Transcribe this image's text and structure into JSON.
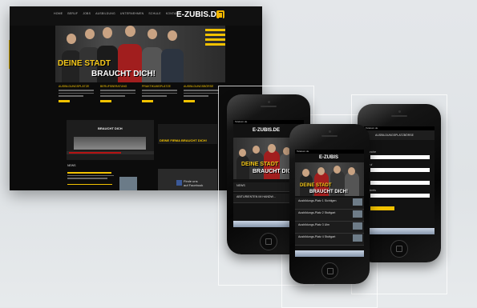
{
  "desktop": {
    "logo": "E-ZUBIS.DE",
    "nav": [
      "HOME",
      "BERUF",
      "JOBS",
      "AUSBILDUNG",
      "UNTERNEHMEN",
      "SCHULE",
      "KONTAKT"
    ],
    "hero_line1": "DEINE STADT",
    "hero_line2": "BRAUCHT DICH!",
    "columns": [
      "AUSBILDUNGSPLÄTZE",
      "BERUFSBERATUNG",
      "PRAKTIKUMSPLÄTZE",
      "AUSBILDUNGSBÖRSE"
    ],
    "video_title": "BRAUCHT DICH",
    "right_title": "DEINE FIRMA BRAUCHT DICH!",
    "news_label": "NEWS",
    "facebook_text": [
      "Finde uns",
      "auf Facebook"
    ]
  },
  "phone_left": {
    "status": "Telekom.de",
    "logo": "E-ZUBIS.DE",
    "hero_line1": "DEINE STADT",
    "hero_line2": "BRAUCHT DICH!",
    "rows": [
      "NEWS",
      "ABITURIENTEN IM HANDW..."
    ]
  },
  "phone_middle": {
    "status": "Telekom.de",
    "logo": "E-ZUBIS",
    "hero_line1": "DEINE STADT",
    "hero_line2": "BRAUCHT DICH!",
    "rows": [
      "Ausbildungs-Platz 1 Sichtigen",
      "Ausbildungs-Platz 2 Stuttgart",
      "Ausbildungs-Platz 3 Ulm",
      "Ausbildungs-Platz 4 Stuttgart"
    ]
  },
  "phone_right": {
    "status": "Telekom.de",
    "header": "AUSBILDUNGSPLATZBÖRSE",
    "labels": [
      "Branche",
      "Beruf",
      "Ort",
      "Umkreis"
    ]
  },
  "colors": {
    "accent": "#f2c200",
    "page_bg": "#e4e7ea"
  }
}
